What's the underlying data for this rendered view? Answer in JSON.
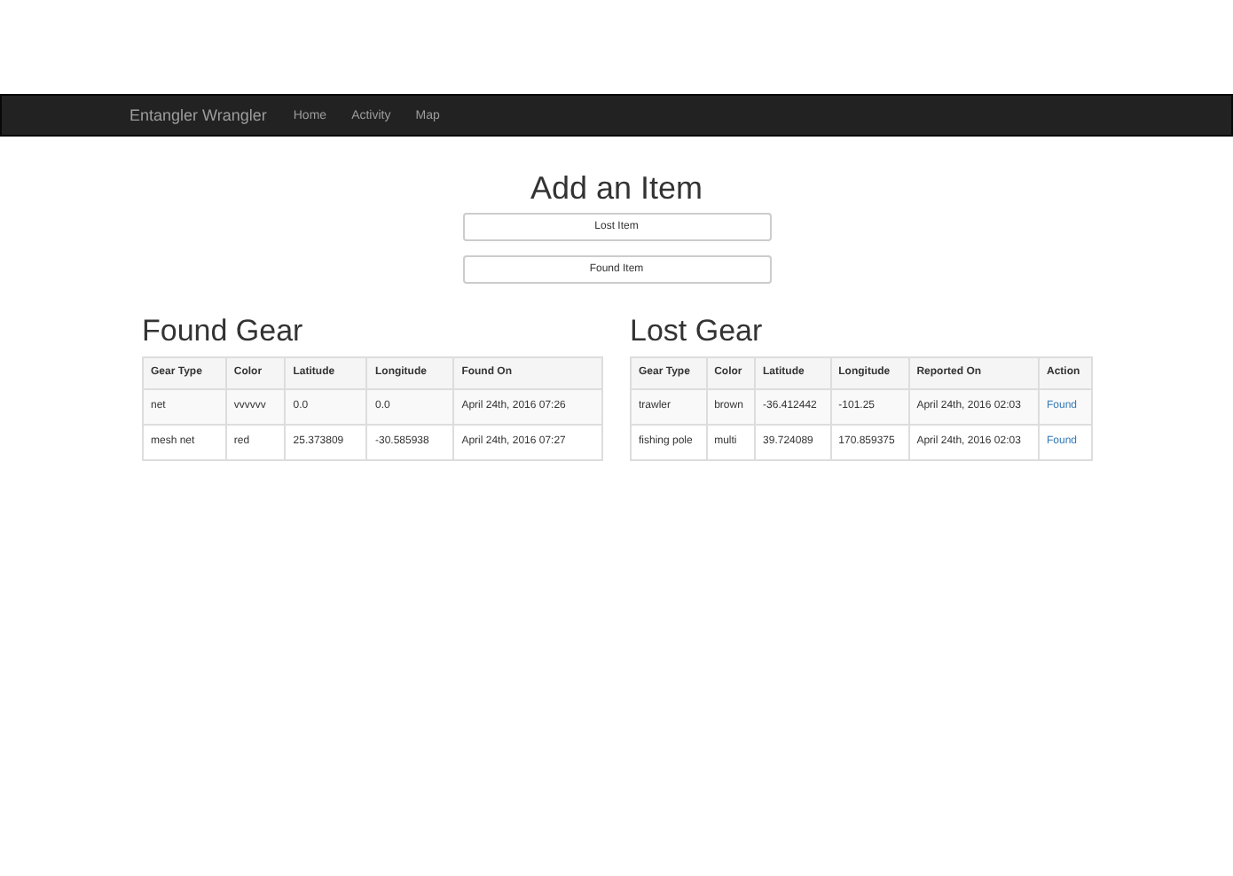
{
  "navbar": {
    "brand": "Entangler Wrangler",
    "links": [
      "Home",
      "Activity",
      "Map"
    ]
  },
  "add_item": {
    "title": "Add an Item",
    "buttons": [
      "Lost Item",
      "Found Item"
    ]
  },
  "found_gear": {
    "title": "Found Gear",
    "columns": [
      "Gear Type",
      "Color",
      "Latitude",
      "Longitude",
      "Found On"
    ],
    "rows": [
      [
        "net",
        "vvvvvv",
        "0.0",
        "0.0",
        "April 24th, 2016 07:26"
      ],
      [
        "mesh net",
        "red",
        "25.373809",
        "-30.585938",
        "April 24th, 2016 07:27"
      ]
    ]
  },
  "lost_gear": {
    "title": "Lost Gear",
    "columns": [
      "Gear Type",
      "Color",
      "Latitude",
      "Longitude",
      "Reported On",
      "Action"
    ],
    "rows": [
      {
        "cells": [
          "trawler",
          "brown",
          "-36.412442",
          "-101.25",
          "April 24th, 2016 02:03"
        ],
        "action": "Found"
      },
      {
        "cells": [
          "fishing pole",
          "multi",
          "39.724089",
          "170.859375",
          "April 24th, 2016 02:03"
        ],
        "action": "Found"
      }
    ]
  }
}
